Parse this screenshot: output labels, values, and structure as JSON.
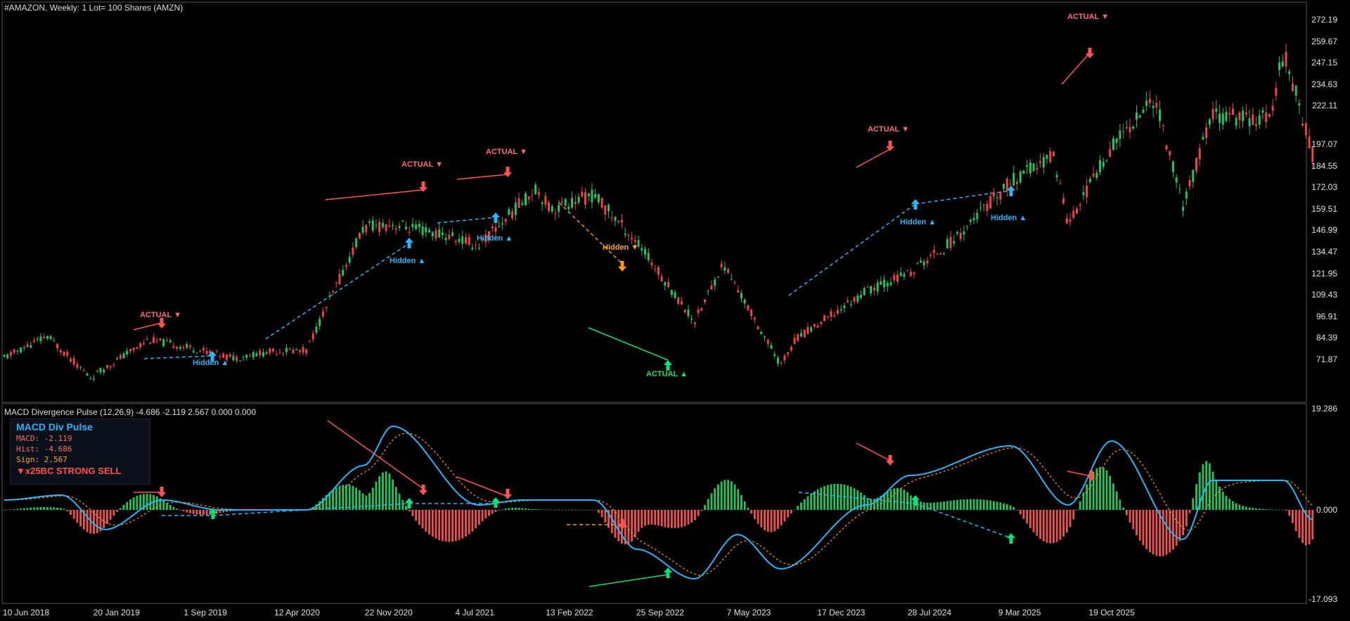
{
  "main_title": "#AMAZON, Weekly:  1 Lot= 100 Shares (AMZN)",
  "sub_title": "MACD Divergence Pulse (12,26,9) -4.686 -2.119 2.567 0.000 0.000",
  "colors": {
    "bull": "#22c55e",
    "bear": "#ef4444",
    "macd": "#29b6f6",
    "signal": "#ff9800",
    "hist_pos": "#22c55e",
    "hist_neg": "#ef5350",
    "bearish_div": "#ff5252",
    "hidden_div": "#29b6f6",
    "bullish_div": "#00e676"
  },
  "price_axis": [
    "272.19",
    "259.67",
    "247.15",
    "234.63",
    "222.11",
    "197.07",
    "184.55",
    "172.03",
    "159.51",
    "146.99",
    "134.47",
    "121.95",
    "109.43",
    "96.91",
    "84.39",
    "71.87"
  ],
  "indicator_axis": {
    "top": "19.286",
    "zero": "0.000",
    "bottom": "-17.093"
  },
  "date_axis": [
    "10 Jun 2018",
    "20 Jan 2019",
    "1 Sep 2019",
    "12 Apr 2020",
    "22 Nov 2020",
    "4 Jul 2021",
    "13 Feb 2022",
    "25 Sep 2022",
    "7 May 2023",
    "17 Dec 2023",
    "28 Jul 2024",
    "9 Mar 2025",
    "19 Oct 2025"
  ],
  "info_panel": {
    "title": "MACD Div Pulse",
    "macd": "MACD: -2.119",
    "hist": "Hist: -4.686",
    "sign": "Sign: 2.567",
    "signal": "▼x25BC STRONG SELL"
  },
  "annotations": [
    {
      "text": "ACTUAL ▼",
      "kind": "bearish"
    },
    {
      "text": "Hidden ▲",
      "kind": "hidden"
    },
    {
      "text": "Hidden ▲",
      "kind": "hidden"
    },
    {
      "text": "ACTUAL ▼",
      "kind": "bearish"
    },
    {
      "text": "Hidden ▲",
      "kind": "hidden"
    },
    {
      "text": "ACTUAL ▼",
      "kind": "bearish"
    },
    {
      "text": "Hidden ▼",
      "kind": "hidden_bear"
    },
    {
      "text": "ACTUAL ▲",
      "kind": "bullish"
    },
    {
      "text": "ACTUAL ▼",
      "kind": "bearish"
    },
    {
      "text": "Hidden ▲",
      "kind": "hidden"
    },
    {
      "text": "Hidden ▲",
      "kind": "hidden"
    },
    {
      "text": "ACTUAL ▼",
      "kind": "bearish"
    }
  ],
  "chart_data": {
    "type": "candlestick",
    "x_range": [
      "Jun 2018",
      "Dec 2025"
    ],
    "y_range": [
      65,
      278
    ],
    "price_path": [
      [
        "2018-06",
        88
      ],
      [
        "2018-09",
        100
      ],
      [
        "2018-12",
        77
      ],
      [
        "2019-04",
        98
      ],
      [
        "2019-06",
        95
      ],
      [
        "2019-10",
        88
      ],
      [
        "2020-01",
        92
      ],
      [
        "2020-03",
        92
      ],
      [
        "2020-07",
        160
      ],
      [
        "2020-09",
        162
      ],
      [
        "2021-01",
        155
      ],
      [
        "2021-03",
        150
      ],
      [
        "2021-07",
        182
      ],
      [
        "2021-08",
        170
      ],
      [
        "2021-11",
        178
      ],
      [
        "2022-02",
        152
      ],
      [
        "2022-06",
        108
      ],
      [
        "2022-08",
        140
      ],
      [
        "2022-12",
        84
      ],
      [
        "2023-01",
        98
      ],
      [
        "2023-06",
        125
      ],
      [
        "2023-09",
        135
      ],
      [
        "2023-12",
        153
      ],
      [
        "2024-04",
        185
      ],
      [
        "2024-07",
        200
      ],
      [
        "2024-08",
        162
      ],
      [
        "2024-11",
        205
      ],
      [
        "2025-02",
        232
      ],
      [
        "2025-04",
        172
      ],
      [
        "2025-06",
        222
      ],
      [
        "2025-10",
        220
      ],
      [
        "2025-11",
        258
      ],
      [
        "2025-12",
        230
      ],
      [
        "2026-01",
        200
      ]
    ],
    "indicator_range": [
      -17.093,
      19.286
    ],
    "macd_path": [
      [
        "2018-06",
        2
      ],
      [
        "2018-10",
        3
      ],
      [
        "2019-01",
        -4
      ],
      [
        "2019-05",
        2
      ],
      [
        "2019-09",
        0
      ],
      [
        "2020-03",
        0
      ],
      [
        "2020-07",
        9
      ],
      [
        "2020-09",
        17
      ],
      [
        "2021-03",
        1
      ],
      [
        "2021-06",
        2
      ],
      [
        "2021-11",
        2
      ],
      [
        "2022-02",
        -8
      ],
      [
        "2022-06",
        -14
      ],
      [
        "2022-09",
        -5
      ],
      [
        "2022-12",
        -12
      ],
      [
        "2023-06",
        1
      ],
      [
        "2023-09",
        7
      ],
      [
        "2024-04",
        13
      ],
      [
        "2024-08",
        1
      ],
      [
        "2024-11",
        14
      ],
      [
        "2025-04",
        -6
      ],
      [
        "2025-06",
        6
      ],
      [
        "2025-11",
        6
      ],
      [
        "2026-01",
        -2
      ]
    ]
  }
}
